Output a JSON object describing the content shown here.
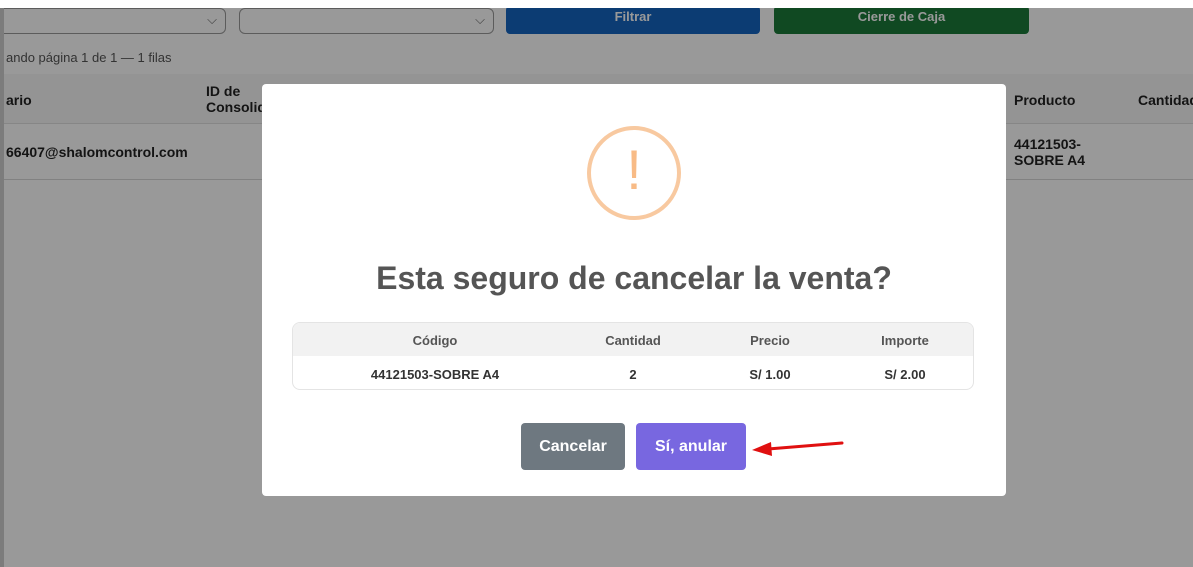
{
  "toolbar": {
    "filter_label": "Filtrar",
    "close_cash_label": "Cierre de Caja",
    "select1_chevron": "⌵",
    "select2_chevron": "⌵"
  },
  "pagination": {
    "info": "ando página 1 de 1 — 1 filas"
  },
  "table": {
    "headers": {
      "usuario": "ario",
      "consolidado_line1": "ID de",
      "consolidado_line2": "Consolid",
      "producto": "Producto",
      "cantidad": "Cantidad"
    },
    "row": {
      "usuario": "66407@shalomcontrol.com",
      "producto_line1": "44121503-",
      "producto_line2": "SOBRE A4"
    }
  },
  "modal": {
    "icon": "warning-icon",
    "icon_glyph": "!",
    "title": "Esta seguro de cancelar la venta?",
    "detail": {
      "headers": [
        "Código",
        "Cantidad",
        "Precio",
        "Importe"
      ],
      "rows": [
        [
          "44121503-SOBRE A4",
          "2",
          "S/ 1.00",
          "S/ 2.00"
        ]
      ]
    },
    "cancel_label": "Cancelar",
    "confirm_label": "Sí, anular"
  },
  "colors": {
    "filter_button": "#1565c0",
    "close_cash_button": "#1b7a3a",
    "cancel_button": "#6e7880",
    "confirm_button": "#7867e0",
    "warning": "#f8bb86",
    "annotation_arrow": "#e01010"
  }
}
